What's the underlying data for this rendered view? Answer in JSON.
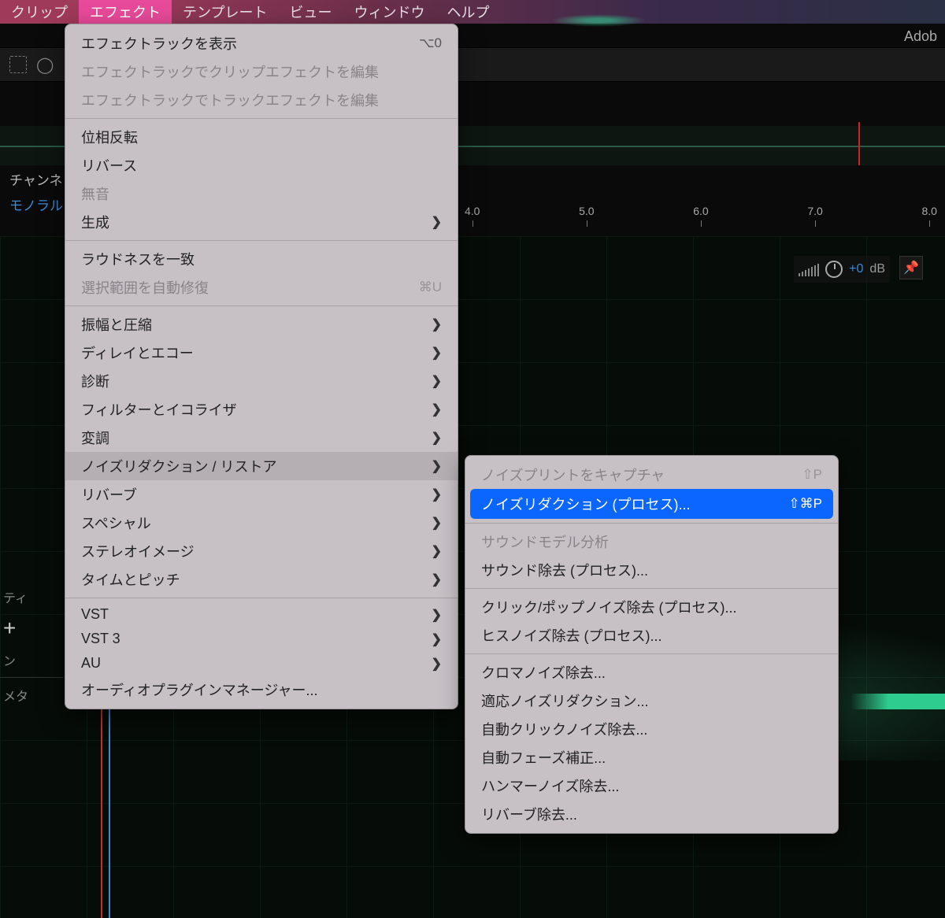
{
  "menubar": {
    "items": [
      "クリップ",
      "エフェクト",
      "テンプレート",
      "ビュー",
      "ウィンドウ",
      "ヘルプ"
    ],
    "active_index": 1
  },
  "app_title_fragment": "Adob",
  "sidebar": {
    "label_channel": "チャンネ",
    "label_mono": "モノラル"
  },
  "timeline": {
    "ticks": [
      "4.0",
      "5.0",
      "6.0",
      "7.0",
      "8.0"
    ]
  },
  "hud": {
    "db_value": "+0",
    "db_unit": "dB"
  },
  "props_sidebar": {
    "tee": "ティ",
    "plus": "+",
    "nn": "ン",
    "metadata": "メタ"
  },
  "main_menu": {
    "groups": [
      [
        {
          "label": "エフェクトラックを表示",
          "shortcut": "⌥0"
        },
        {
          "label": "エフェクトラックでクリップエフェクトを編集",
          "disabled": true
        },
        {
          "label": "エフェクトラックでトラックエフェクトを編集",
          "disabled": true
        }
      ],
      [
        {
          "label": "位相反転"
        },
        {
          "label": "リバース"
        },
        {
          "label": "無音",
          "disabled": true
        },
        {
          "label": "生成",
          "submenu": true
        }
      ],
      [
        {
          "label": "ラウドネスを一致"
        },
        {
          "label": "選択範囲を自動修復",
          "shortcut": "⌘U",
          "disabled": true
        }
      ],
      [
        {
          "label": "振幅と圧縮",
          "submenu": true
        },
        {
          "label": "ディレイとエコー",
          "submenu": true
        },
        {
          "label": "診断",
          "submenu": true
        },
        {
          "label": "フィルターとイコライザ",
          "submenu": true
        },
        {
          "label": "変調",
          "submenu": true
        },
        {
          "label": "ノイズリダクション / リストア",
          "submenu": true,
          "hover": true
        },
        {
          "label": "リバーブ",
          "submenu": true
        },
        {
          "label": "スペシャル",
          "submenu": true
        },
        {
          "label": "ステレオイメージ",
          "submenu": true
        },
        {
          "label": "タイムとピッチ",
          "submenu": true
        }
      ],
      [
        {
          "label": "VST",
          "submenu": true
        },
        {
          "label": "VST 3",
          "submenu": true
        },
        {
          "label": "AU",
          "submenu": true
        },
        {
          "label": "オーディオプラグインマネージャー..."
        }
      ]
    ]
  },
  "sub_menu": {
    "groups": [
      [
        {
          "label": "ノイズプリントをキャプチャ",
          "shortcut": "⇧P",
          "disabled": true
        },
        {
          "label": "ノイズリダクション (プロセス)...",
          "shortcut": "⇧⌘P",
          "highlight": true
        }
      ],
      [
        {
          "label": "サウンドモデル分析",
          "disabled": true
        },
        {
          "label": "サウンド除去 (プロセス)..."
        }
      ],
      [
        {
          "label": "クリック/ポップノイズ除去 (プロセス)..."
        },
        {
          "label": "ヒスノイズ除去 (プロセス)..."
        }
      ],
      [
        {
          "label": "クロマノイズ除去..."
        },
        {
          "label": "適応ノイズリダクション..."
        },
        {
          "label": "自動クリックノイズ除去..."
        },
        {
          "label": "自動フェーズ補正..."
        },
        {
          "label": "ハンマーノイズ除去..."
        },
        {
          "label": "リバーブ除去..."
        }
      ]
    ]
  },
  "glyphs": {
    "chevron_right": "❯"
  }
}
